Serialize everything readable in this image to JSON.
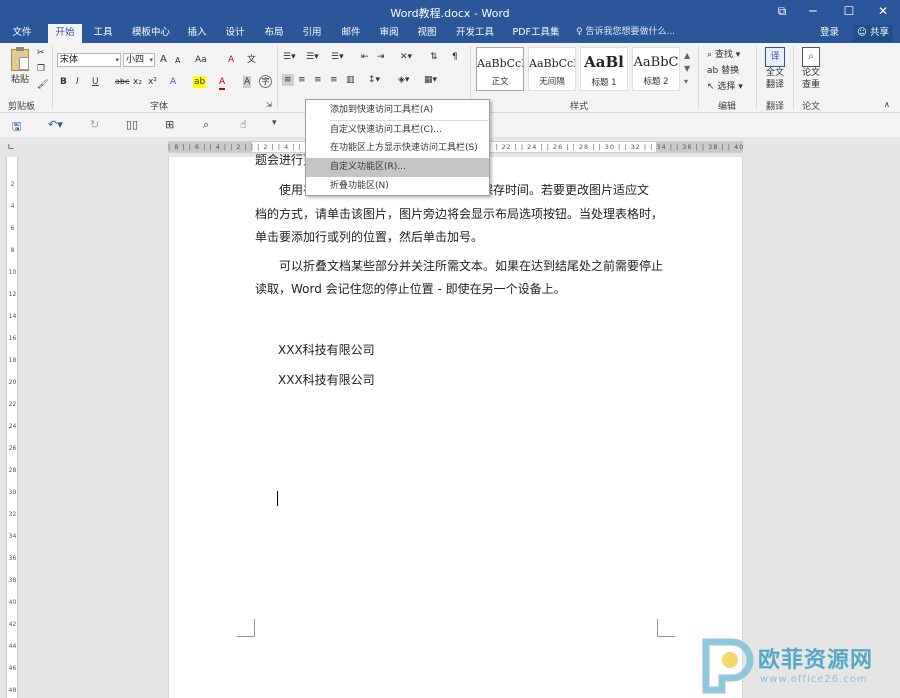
{
  "window": {
    "title": "Word教程.docx - Word",
    "controls": {
      "restore": "⧉",
      "minimize": "─",
      "maximize": "☐",
      "close": "✕"
    }
  },
  "tabs": [
    {
      "label": "文件"
    },
    {
      "label": "开始",
      "active": true
    },
    {
      "label": "工具"
    },
    {
      "label": "模板中心"
    },
    {
      "label": "插入"
    },
    {
      "label": "设计"
    },
    {
      "label": "布局"
    },
    {
      "label": "引用"
    },
    {
      "label": "邮件"
    },
    {
      "label": "审阅"
    },
    {
      "label": "视图"
    },
    {
      "label": "开发工具"
    },
    {
      "label": "PDF工具集"
    }
  ],
  "tell_me": "告诉我您想要做什么...",
  "login": "登录",
  "share": "共享",
  "ribbon": {
    "clipboard": {
      "paste_label": "粘贴",
      "group_label": "剪贴板"
    },
    "font": {
      "font_name": "宋体",
      "font_size": "小四",
      "group_label": "字体",
      "bold": "B",
      "italic": "I",
      "underline": "U",
      "strike": "abc",
      "subscript": "x₂",
      "superscript": "x²",
      "grow": "A",
      "shrink": "A",
      "case": "Aa",
      "clear": "A",
      "phonetic": "文",
      "text_effect": "A",
      "highlight": "ab",
      "color": "A",
      "shading": "A",
      "enclose": "字"
    },
    "paragraph": {
      "group_label": "段落"
    },
    "styles": {
      "group_label": "样式",
      "items": [
        {
          "sample": "AaBbCcI",
          "name": "正文",
          "selected": true
        },
        {
          "sample": "AaBbCcI",
          "name": "无间隔"
        },
        {
          "sample": "AaBl",
          "name": "标题 1"
        },
        {
          "sample": "AaBbC",
          "name": "标题 2"
        }
      ]
    },
    "editing": {
      "find": "查找",
      "replace": "替换",
      "select": "选择",
      "group_label": "编辑"
    },
    "translate": {
      "label1": "全文",
      "label2": "翻译",
      "group_label": "翻译"
    },
    "paper": {
      "label1": "论文",
      "label2": "查重",
      "group_label": "论文"
    }
  },
  "context_menu": {
    "items": [
      {
        "label": "添加到快速访问工具栏(A)"
      },
      {
        "label": "自定义快速访问工具栏(C)..."
      },
      {
        "label": "在功能区上方显示快速访问工具栏(S)"
      },
      {
        "label": "自定义功能区(R)...",
        "highlighted": true
      },
      {
        "label": "折叠功能区(N)"
      }
    ]
  },
  "ruler": {
    "h_numbers": "| 8 | | 6 | | 4 | | 2 | | | 2 | | 4 | | 6 | | 8 | | 10 | | 12 | | 14 | | 16 | | 18 | | 20 | | 22 | | 24 | | 26 | | 28 | | 30 | | 32 | | 34 | | 36 | | 38 | | 40 | | 42 |",
    "v_numbers": [
      "2",
      "4",
      "6",
      "8",
      "10",
      "12",
      "14",
      "16",
      "18",
      "20",
      "22",
      "24",
      "26",
      "28",
      "30",
      "32",
      "34",
      "36",
      "38",
      "40",
      "42",
      "44",
      "46",
      "48"
    ]
  },
  "document": {
    "line0": "题会进行更",
    "para1": {
      "l1a": "使用在",
      "l1b": "保存时间。若要更改图片适应文",
      "l2": "档的方式，请单击该图片，图片旁边将会显示布局选项按钮。当处理表格时，",
      "l3": "单击要添加行或列的位置，然后单击加号。"
    },
    "para2": {
      "l1": "可以折叠文档某些部分并关注所需文本。如果在达到结尾处之前需要停止",
      "l2": "读取，Word 会记住您的停止位置 - 即使在另一个设备上。"
    },
    "company1": "XXX科技有限公司",
    "company2": "XXX科技有限公司"
  },
  "watermark": {
    "main": "欧菲资源网",
    "url": "www.office26.com"
  },
  "colors": {
    "accent": "#2b579a",
    "ribbon_bg": "#f3f3f3",
    "watermark": "#55a8c8"
  }
}
